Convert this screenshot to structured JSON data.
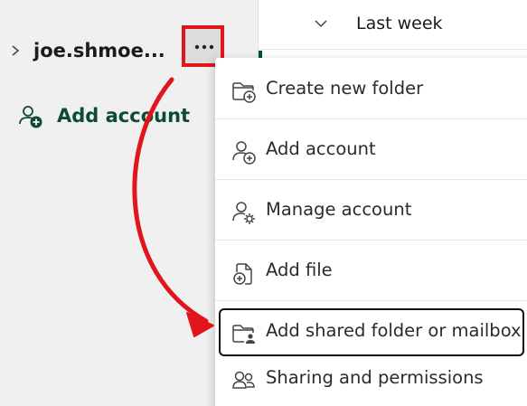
{
  "sidebar": {
    "account_name": "joe.shmoe...",
    "more_icon": "more-horizontal-icon",
    "add_account_label": "Add account",
    "colors": {
      "accent": "#0e4b34",
      "callout": "#e0161c"
    }
  },
  "header": {
    "group_label": "Last week"
  },
  "menu": {
    "items": [
      {
        "label": "Create new folder",
        "icon": "folder-add-icon"
      },
      {
        "label": "Add account",
        "icon": "person-add-icon"
      },
      {
        "label": "Manage account",
        "icon": "person-settings-icon"
      },
      {
        "label": "Add file",
        "icon": "document-add-icon"
      },
      {
        "label": "Add shared folder or mailbox",
        "icon": "folder-person-icon"
      },
      {
        "label": "Sharing and permissions",
        "icon": "people-icon"
      }
    ]
  }
}
